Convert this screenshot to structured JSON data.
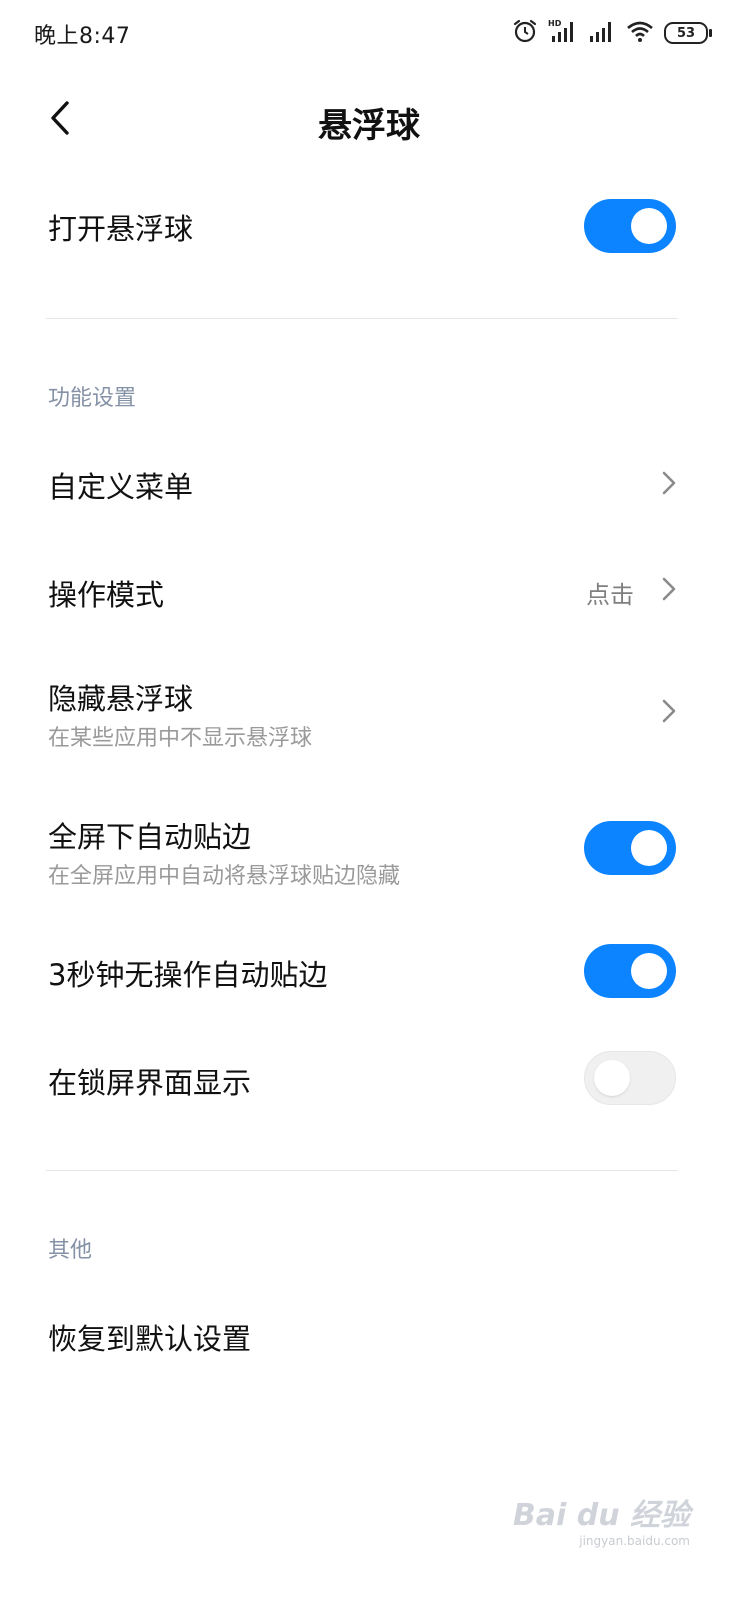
{
  "status_bar": {
    "time": "晚上8:47",
    "battery": "53",
    "icons": [
      "alarm-icon",
      "hd-signal-icon",
      "signal-icon",
      "wifi-icon",
      "battery-icon"
    ]
  },
  "header": {
    "title": "悬浮球",
    "back_icon": "back-chevron-icon"
  },
  "main_toggle": {
    "label": "打开悬浮球",
    "on": true
  },
  "sections": [
    {
      "header": "功能设置",
      "items": [
        {
          "label": "自定义菜单",
          "control": "chevron"
        },
        {
          "label": "操作模式",
          "value": "点击",
          "control": "chevron"
        },
        {
          "label": "隐藏悬浮球",
          "subtitle": "在某些应用中不显示悬浮球",
          "control": "chevron"
        },
        {
          "label": "全屏下自动贴边",
          "subtitle": "在全屏应用中自动将悬浮球贴边隐藏",
          "control": "toggle",
          "on": true
        },
        {
          "label": "3秒钟无操作自动贴边",
          "control": "toggle",
          "on": true
        },
        {
          "label": "在锁屏界面显示",
          "control": "toggle",
          "on": false
        }
      ]
    },
    {
      "header": "其他",
      "items": [
        {
          "label": "恢复到默认设置"
        }
      ]
    }
  ],
  "watermark": {
    "text": "Bai du 经验",
    "url": "jingyan.baidu.com"
  },
  "colors": {
    "accent": "#0d84ff",
    "section_header": "#8592a6",
    "subtitle": "#9a9a9a"
  }
}
